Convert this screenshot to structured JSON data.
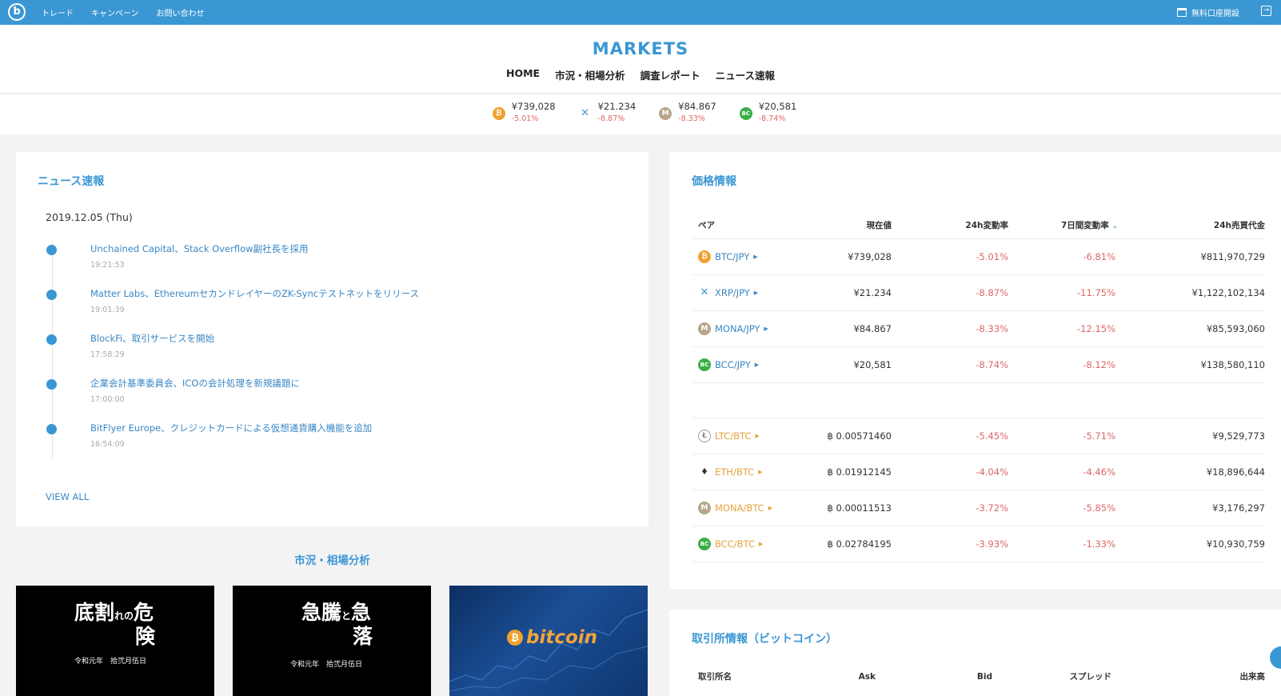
{
  "topbar": {
    "logo_icon": "bitbank-logo-icon",
    "nav": [
      "トレード",
      "キャンペーン",
      "お問い合わせ"
    ],
    "open_account": "無料口座開設",
    "open_account_icon": "bank-icon",
    "logout_icon": "logout-icon"
  },
  "header": {
    "brand": "MARKETS",
    "nav": [
      "HOME",
      "市況・相場分析",
      "調査レポート",
      "ニュース速報"
    ]
  },
  "ticker": [
    {
      "icon": "btc-icon",
      "glyph": "₿",
      "price": "¥739,028",
      "change": "-5.01%"
    },
    {
      "icon": "xrp-icon",
      "glyph": "✕",
      "price": "¥21.234",
      "change": "-8.87%"
    },
    {
      "icon": "mona-icon",
      "glyph": "M",
      "price": "¥84.867",
      "change": "-8.33%"
    },
    {
      "icon": "bcc-icon",
      "glyph": "BC",
      "price": "¥20,581",
      "change": "-8.74%"
    }
  ],
  "news": {
    "title": "ニュース速報",
    "date": "2019.12.05 (Thu)",
    "items": [
      {
        "title": "Unchained Capital、Stack Overflow副社長を採用",
        "time": "19:21:53"
      },
      {
        "title": "Matter Labs、EthereumセカンドレイヤーのZK-Syncテストネットをリリース",
        "time": "19:01:39"
      },
      {
        "title": "BlockFi、取引サービスを開始",
        "time": "17:58:29"
      },
      {
        "title": "企業会計基準委員会、ICOの会計処理を新規議題に",
        "time": "17:00:00"
      },
      {
        "title": "BitFlyer Europe、クレジットカードによる仮想通貨購入機能を追加",
        "time": "16:54:09"
      }
    ],
    "view_all": "VIEW ALL"
  },
  "analysis": {
    "title": "市況・相場分析",
    "cards": [
      {
        "line1a": "底割",
        "line1b": "れの",
        "line1c": "危",
        "line2": "険",
        "sub": "令和元年　拾弐月伍日"
      },
      {
        "line1a": "急騰",
        "line1b": "と",
        "line1c": "急",
        "line2": "落",
        "sub": "令和元年　拾弐月伍日"
      },
      {
        "word": "bitcoin",
        "glyph": "₿"
      }
    ]
  },
  "prices": {
    "title": "価格情報",
    "columns": [
      "ペア",
      "現在値",
      "24h変動率",
      "7日間変動率",
      "24h売買代金"
    ],
    "sort_icon": "chevron-down-icon",
    "jpy_rows": [
      {
        "icon": "btc-icon",
        "glyph": "₿",
        "pair": "BTC/JPY",
        "price": "¥739,028",
        "chg24": "-5.01%",
        "chg7d": "-6.81%",
        "volume": "¥811,970,729"
      },
      {
        "icon": "xrp-icon",
        "glyph": "✕",
        "pair": "XRP/JPY",
        "price": "¥21.234",
        "chg24": "-8.87%",
        "chg7d": "-11.75%",
        "volume": "¥1,122,102,134"
      },
      {
        "icon": "mona-icon",
        "glyph": "M",
        "pair": "MONA/JPY",
        "price": "¥84.867",
        "chg24": "-8.33%",
        "chg7d": "-12.15%",
        "volume": "¥85,593,060"
      },
      {
        "icon": "bcc-icon",
        "glyph": "BC",
        "pair": "BCC/JPY",
        "price": "¥20,581",
        "chg24": "-8.74%",
        "chg7d": "-8.12%",
        "volume": "¥138,580,110"
      }
    ],
    "btc_rows": [
      {
        "icon": "ltc-icon",
        "glyph": "Ł",
        "pair": "LTC/BTC",
        "price": "฿ 0.00571460",
        "chg24": "-5.45%",
        "chg7d": "-5.71%",
        "volume": "¥9,529,773"
      },
      {
        "icon": "eth-icon",
        "glyph": "♦",
        "pair": "ETH/BTC",
        "price": "฿ 0.01912145",
        "chg24": "-4.04%",
        "chg7d": "-4.46%",
        "volume": "¥18,896,644"
      },
      {
        "icon": "mona-icon",
        "glyph": "M",
        "pair": "MONA/BTC",
        "price": "฿ 0.00011513",
        "chg24": "-3.72%",
        "chg7d": "-5.85%",
        "volume": "¥3,176,297"
      },
      {
        "icon": "bcc-icon",
        "glyph": "BC",
        "pair": "BCC/BTC",
        "price": "฿ 0.02784195",
        "chg24": "-3.93%",
        "chg7d": "-1.33%",
        "volume": "¥10,930,759"
      }
    ]
  },
  "exchange": {
    "title": "取引所情報（ビットコイン）",
    "columns": [
      "取引所名",
      "Ask",
      "Bid",
      "スプレッド",
      "出来高"
    ]
  },
  "colors": {
    "accent": "#3a97d4",
    "negative": "#dd6666",
    "btc_orange": "#f0a12e",
    "bcc_green": "#3cae48"
  }
}
